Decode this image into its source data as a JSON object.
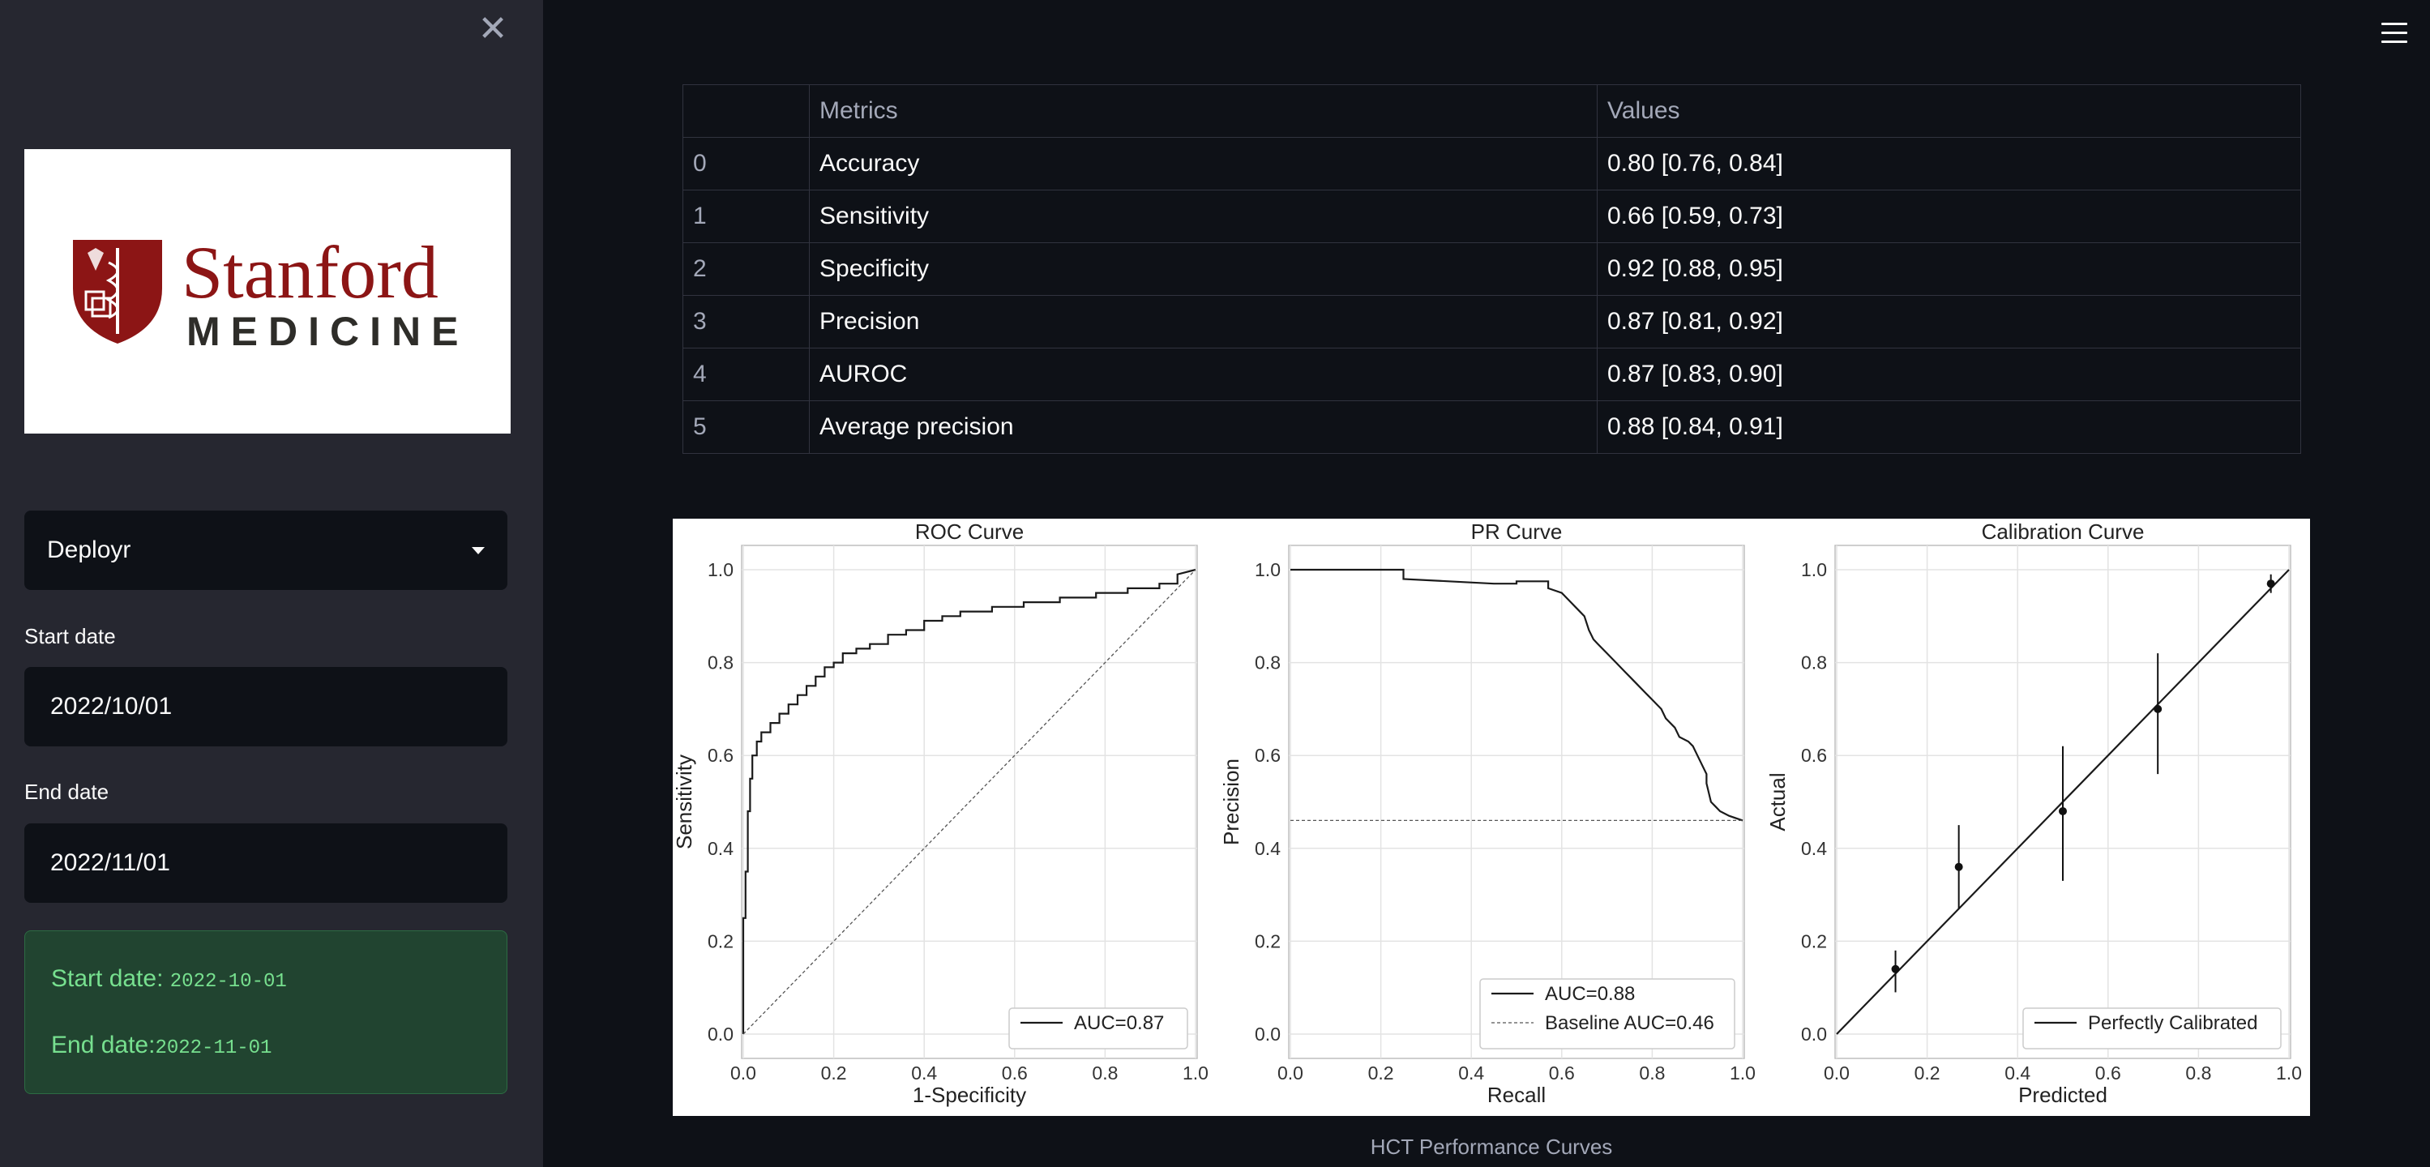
{
  "sidebar": {
    "close_icon": "✕",
    "logo": {
      "name": "Stanford",
      "subtitle": "MEDICINE",
      "brand_color": "#8c1515"
    },
    "model_select": {
      "value": "Deployr"
    },
    "start_date": {
      "label": "Start date",
      "value": "2022/10/01"
    },
    "end_date": {
      "label": "End date",
      "value": "2022/11/01"
    },
    "alert": {
      "start_label": "Start date:",
      "start_value": "2022-10-01",
      "end_label": "End date:",
      "end_value": "2022-11-01"
    }
  },
  "header": {
    "menu_icon": "hamburger-icon"
  },
  "metrics_table": {
    "headers": [
      "",
      "Metrics",
      "Values"
    ],
    "rows": [
      [
        "0",
        "Accuracy",
        "0.80 [0.76, 0.84]"
      ],
      [
        "1",
        "Sensitivity",
        "0.66 [0.59, 0.73]"
      ],
      [
        "2",
        "Specificity",
        "0.92 [0.88, 0.95]"
      ],
      [
        "3",
        "Precision",
        "0.87 [0.81, 0.92]"
      ],
      [
        "4",
        "AUROC",
        "0.87 [0.83, 0.90]"
      ],
      [
        "5",
        "Average precision",
        "0.88 [0.84, 0.91]"
      ]
    ]
  },
  "chart_caption": "HCT Performance Curves",
  "chart_data": [
    {
      "type": "line",
      "title": "ROC Curve",
      "xlabel": "1-Specificity",
      "ylabel": "Sensitivity",
      "xlim": [
        0,
        1
      ],
      "ylim": [
        0,
        1
      ],
      "xticks": [
        "0.0",
        "0.2",
        "0.4",
        "0.6",
        "0.8",
        "1.0"
      ],
      "yticks": [
        "0.0",
        "0.2",
        "0.4",
        "0.6",
        "0.8",
        "1.0"
      ],
      "grid": true,
      "legend": {
        "position": "lower-right",
        "entries": [
          "AUC=0.87"
        ]
      },
      "series": [
        {
          "name": "AUC=0.87",
          "style": "solid",
          "x": [
            0,
            0,
            0.005,
            0.005,
            0.01,
            0.01,
            0.015,
            0.015,
            0.02,
            0.02,
            0.03,
            0.03,
            0.04,
            0.04,
            0.06,
            0.06,
            0.08,
            0.08,
            0.1,
            0.1,
            0.12,
            0.12,
            0.14,
            0.14,
            0.16,
            0.16,
            0.18,
            0.18,
            0.2,
            0.2,
            0.22,
            0.22,
            0.25,
            0.25,
            0.28,
            0.28,
            0.32,
            0.32,
            0.36,
            0.36,
            0.4,
            0.4,
            0.44,
            0.44,
            0.48,
            0.48,
            0.55,
            0.55,
            0.62,
            0.62,
            0.7,
            0.7,
            0.78,
            0.78,
            0.85,
            0.85,
            0.92,
            0.92,
            0.96,
            0.96,
            1
          ],
          "y": [
            0,
            0.25,
            0.25,
            0.35,
            0.35,
            0.48,
            0.48,
            0.55,
            0.55,
            0.6,
            0.6,
            0.63,
            0.63,
            0.65,
            0.65,
            0.67,
            0.67,
            0.69,
            0.69,
            0.71,
            0.71,
            0.73,
            0.73,
            0.75,
            0.75,
            0.77,
            0.77,
            0.79,
            0.79,
            0.8,
            0.8,
            0.82,
            0.82,
            0.83,
            0.83,
            0.84,
            0.84,
            0.86,
            0.86,
            0.87,
            0.87,
            0.89,
            0.89,
            0.9,
            0.9,
            0.91,
            0.91,
            0.92,
            0.92,
            0.93,
            0.93,
            0.94,
            0.94,
            0.95,
            0.95,
            0.96,
            0.96,
            0.97,
            0.97,
            0.99,
            1
          ]
        },
        {
          "style": "dashed",
          "x": [
            0,
            1
          ],
          "y": [
            0,
            1
          ]
        }
      ]
    },
    {
      "type": "line",
      "title": "PR Curve",
      "xlabel": "Recall",
      "ylabel": "Precision",
      "xlim": [
        0,
        1
      ],
      "ylim": [
        0,
        1
      ],
      "xticks": [
        "0.0",
        "0.2",
        "0.4",
        "0.6",
        "0.8",
        "1.0"
      ],
      "yticks": [
        "0.0",
        "0.2",
        "0.4",
        "0.6",
        "0.8",
        "1.0"
      ],
      "grid": true,
      "legend": {
        "position": "lower-right",
        "entries": [
          "AUC=0.88",
          "Baseline AUC=0.46"
        ]
      },
      "series": [
        {
          "name": "AUC=0.88",
          "style": "solid",
          "x": [
            0,
            0.25,
            0.25,
            0.35,
            0.45,
            0.5,
            0.5,
            0.57,
            0.57,
            0.6,
            0.62,
            0.63,
            0.65,
            0.66,
            0.67,
            0.68,
            0.7,
            0.72,
            0.74,
            0.75,
            0.77,
            0.79,
            0.8,
            0.82,
            0.83,
            0.85,
            0.86,
            0.88,
            0.89,
            0.9,
            0.91,
            0.92,
            0.92,
            0.93,
            0.94,
            0.95,
            0.97,
            1
          ],
          "y": [
            1,
            1,
            0.98,
            0.975,
            0.97,
            0.97,
            0.975,
            0.975,
            0.96,
            0.95,
            0.93,
            0.92,
            0.9,
            0.87,
            0.85,
            0.84,
            0.82,
            0.8,
            0.78,
            0.77,
            0.75,
            0.73,
            0.72,
            0.7,
            0.68,
            0.66,
            0.64,
            0.63,
            0.62,
            0.6,
            0.58,
            0.56,
            0.54,
            0.5,
            0.49,
            0.48,
            0.47,
            0.46
          ]
        },
        {
          "name": "Baseline AUC=0.46",
          "style": "dashed",
          "x": [
            0,
            1
          ],
          "y": [
            0.46,
            0.46
          ]
        }
      ]
    },
    {
      "type": "scatter",
      "title": "Calibration Curve",
      "xlabel": "Predicted",
      "ylabel": "Actual",
      "xlim": [
        0,
        1
      ],
      "ylim": [
        0,
        1
      ],
      "xticks": [
        "0.0",
        "0.2",
        "0.4",
        "0.6",
        "0.8",
        "1.0"
      ],
      "yticks": [
        "0.0",
        "0.2",
        "0.4",
        "0.6",
        "0.8",
        "1.0"
      ],
      "grid": true,
      "legend": {
        "position": "lower-right",
        "entries": [
          "Perfectly Calibrated"
        ]
      },
      "series": [
        {
          "name": "Perfectly Calibrated",
          "style": "solid",
          "x": [
            0,
            1
          ],
          "y": [
            0,
            1
          ]
        }
      ],
      "points": [
        {
          "x": 0.13,
          "y": 0.14,
          "lo": 0.09,
          "hi": 0.18
        },
        {
          "x": 0.27,
          "y": 0.36,
          "lo": 0.27,
          "hi": 0.45
        },
        {
          "x": 0.5,
          "y": 0.48,
          "lo": 0.33,
          "hi": 0.62
        },
        {
          "x": 0.71,
          "y": 0.7,
          "lo": 0.56,
          "hi": 0.82
        },
        {
          "x": 0.96,
          "y": 0.97,
          "lo": 0.95,
          "hi": 0.99
        }
      ]
    }
  ]
}
